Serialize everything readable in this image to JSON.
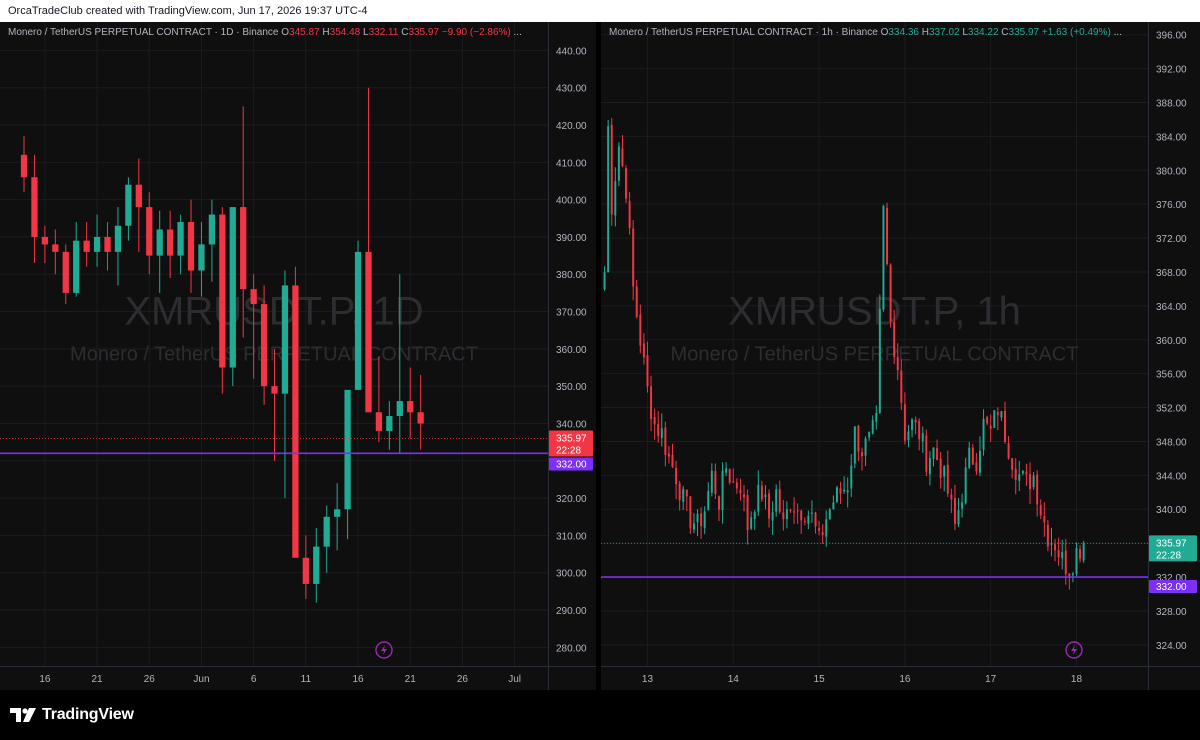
{
  "header": {
    "credit": "OrcaTradeClub created with TradingView.com, Jun 17, 2026 19:37 UTC-4"
  },
  "footer": {
    "brand": "TradingView"
  },
  "colors": {
    "up": "#22ab94",
    "down": "#f23645",
    "level_line": "#7b2ff7",
    "background": "#0f0f0f"
  },
  "charts": [
    {
      "legend": {
        "symbol": "Monero / TetherUS PERPETUAL CONTRACT · 1D · Binance",
        "o_label": "O",
        "o": "345.87",
        "h_label": "H",
        "h": "354.48",
        "l_label": "L",
        "l": "332.11",
        "c_label": "C",
        "c": "335.97",
        "change": "−9.90 (−2.86%)",
        "more": "...",
        "direction": "down"
      },
      "watermark": {
        "ticker": "XMRUSDT.P, 1D",
        "name": "Monero / TetherUS PERPETUAL CONTRACT"
      },
      "price_tag": {
        "value": "335.97",
        "countdown": "22:28",
        "color": "#f23645"
      },
      "level_tag": {
        "value": "332.00"
      },
      "lightning_icon": "lightning-icon"
    },
    {
      "legend": {
        "symbol": "Monero / TetherUS PERPETUAL CONTRACT · 1h · Binance",
        "o_label": "O",
        "o": "334.36",
        "h_label": "H",
        "h": "337.02",
        "l_label": "L",
        "l": "334.22",
        "c_label": "C",
        "c": "335.97",
        "change": "+1.63 (+0.49%)",
        "more": "...",
        "direction": "up"
      },
      "watermark": {
        "ticker": "XMRUSDT.P, 1h",
        "name": "Monero / TetherUS PERPETUAL CONTRACT"
      },
      "price_tag": {
        "value": "335.97",
        "countdown": "22:28",
        "color": "#22ab94"
      },
      "level_tag": {
        "value": "332.00"
      },
      "lightning_icon": "lightning-icon"
    }
  ],
  "chart_data": [
    {
      "type": "candlestick",
      "title": "XMRUSDT.P, 1D",
      "ylim": [
        275,
        446
      ],
      "y_ticks": [
        "280.00",
        "290.00",
        "300.00",
        "310.00",
        "320.00",
        "330.00",
        "340.00",
        "350.00",
        "360.00",
        "370.00",
        "380.00",
        "390.00",
        "400.00",
        "410.00",
        "420.00",
        "430.00",
        "440.00"
      ],
      "x_ticks": [
        "16",
        "21",
        "26",
        "Jun",
        "6",
        "11",
        "16",
        "21",
        "26",
        "Jul"
      ],
      "x_tick_index": [
        2,
        7,
        12,
        17,
        22,
        27,
        32,
        37,
        42,
        47
      ],
      "index_range": [
        -2.3,
        50.2
      ],
      "current_price": 335.97,
      "level": 332.0,
      "candles": [
        [
          412,
          417,
          402,
          406
        ],
        [
          406,
          412,
          383,
          390
        ],
        [
          390,
          393,
          383,
          388
        ],
        [
          388,
          392,
          380,
          386
        ],
        [
          386,
          388,
          372,
          375
        ],
        [
          375,
          394,
          374,
          389
        ],
        [
          389,
          394,
          382,
          386
        ],
        [
          386,
          396,
          382,
          390
        ],
        [
          390,
          394,
          381,
          386
        ],
        [
          386,
          398,
          377,
          393
        ],
        [
          393,
          406,
          389,
          404
        ],
        [
          404,
          411,
          386,
          398
        ],
        [
          398,
          402,
          380,
          385
        ],
        [
          385,
          397,
          375,
          392
        ],
        [
          392,
          397,
          379,
          385
        ],
        [
          385,
          396,
          380,
          394
        ],
        [
          394,
          400,
          375,
          381
        ],
        [
          381,
          394,
          374,
          388
        ],
        [
          388,
          400,
          378,
          396
        ],
        [
          396,
          398,
          348,
          355
        ],
        [
          355,
          396,
          350,
          398
        ],
        [
          398,
          425,
          363,
          376
        ],
        [
          376,
          380,
          352,
          372
        ],
        [
          372,
          377,
          345,
          350
        ],
        [
          350,
          360,
          330,
          348
        ],
        [
          348,
          381,
          320,
          377
        ],
        [
          377,
          382,
          320,
          304
        ],
        [
          304,
          310,
          293,
          297
        ],
        [
          297,
          312,
          292,
          307
        ],
        [
          307,
          318,
          300,
          315
        ],
        [
          315,
          324,
          306,
          317
        ],
        [
          317,
          341,
          309,
          349
        ],
        [
          349,
          389,
          350,
          386
        ],
        [
          386,
          430,
          356,
          343
        ],
        [
          343,
          358,
          335,
          338
        ],
        [
          338,
          346,
          333,
          342
        ],
        [
          342,
          380,
          332,
          346
        ],
        [
          346,
          355,
          336,
          343
        ],
        [
          343,
          353,
          333,
          340
        ]
      ]
    },
    {
      "type": "candlestick",
      "title": "XMRUSDT.P, 1h",
      "ylim": [
        321.5,
        397.5
      ],
      "y_ticks": [
        "324.00",
        "328.00",
        "332.00",
        "336.00",
        "340.00",
        "344.00",
        "348.00",
        "352.00",
        "356.00",
        "360.00",
        "364.00",
        "368.00",
        "372.00",
        "376.00",
        "380.00",
        "384.00",
        "388.00",
        "392.00",
        "396.00"
      ],
      "x_ticks": [
        "13",
        "14",
        "15",
        "16",
        "17",
        "18"
      ],
      "x_tick_index": [
        12,
        36,
        60,
        84,
        108,
        132
      ],
      "index_range": [
        -1,
        152
      ],
      "current_price": 335.97,
      "level": 332.0,
      "anchors": [
        [
          0,
          368
        ],
        [
          1,
          385
        ],
        [
          2,
          376
        ],
        [
          4,
          383
        ],
        [
          6,
          378
        ],
        [
          8,
          366
        ],
        [
          10,
          360
        ],
        [
          12,
          354
        ],
        [
          14,
          350
        ],
        [
          16,
          349
        ],
        [
          18,
          346
        ],
        [
          20,
          344
        ],
        [
          22,
          341
        ],
        [
          24,
          339
        ],
        [
          26,
          338
        ],
        [
          28,
          340
        ],
        [
          30,
          344
        ],
        [
          32,
          341
        ],
        [
          34,
          345
        ],
        [
          36,
          343
        ],
        [
          38,
          343
        ],
        [
          40,
          338
        ],
        [
          42,
          341
        ],
        [
          44,
          342
        ],
        [
          46,
          339
        ],
        [
          48,
          342
        ],
        [
          50,
          338
        ],
        [
          52,
          341
        ],
        [
          54,
          340
        ],
        [
          56,
          340
        ],
        [
          58,
          339
        ],
        [
          60,
          336
        ],
        [
          62,
          339
        ],
        [
          64,
          341
        ],
        [
          66,
          342
        ],
        [
          68,
          343
        ],
        [
          70,
          349
        ],
        [
          72,
          347
        ],
        [
          74,
          348
        ],
        [
          76,
          350
        ],
        [
          78,
          375
        ],
        [
          80,
          362
        ],
        [
          82,
          357
        ],
        [
          84,
          349
        ],
        [
          86,
          350
        ],
        [
          88,
          349
        ],
        [
          90,
          346
        ],
        [
          92,
          347
        ],
        [
          94,
          345
        ],
        [
          96,
          342
        ],
        [
          98,
          338
        ],
        [
          100,
          342
        ],
        [
          102,
          346
        ],
        [
          104,
          346
        ],
        [
          106,
          350
        ],
        [
          108,
          349
        ],
        [
          110,
          352
        ],
        [
          112,
          349
        ],
        [
          114,
          346
        ],
        [
          116,
          344
        ],
        [
          118,
          343
        ],
        [
          120,
          344
        ],
        [
          122,
          340
        ],
        [
          124,
          337
        ],
        [
          126,
          336
        ],
        [
          128,
          334
        ],
        [
          130,
          333
        ],
        [
          132,
          335
        ],
        [
          134,
          336
        ]
      ]
    }
  ]
}
